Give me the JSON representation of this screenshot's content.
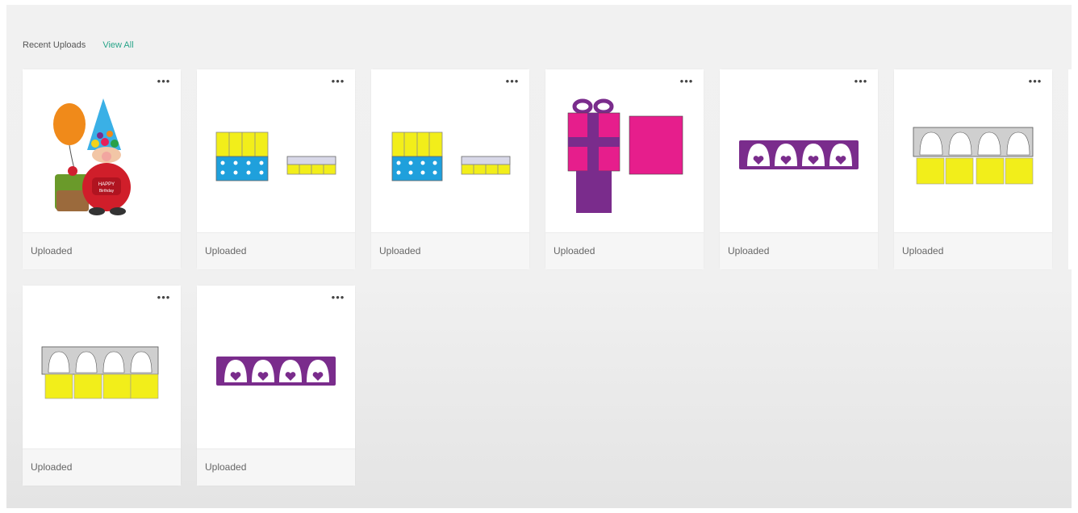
{
  "section": {
    "title": "Recent Uploads",
    "view_all": "View All"
  },
  "more_label": "•••",
  "cards": [
    {
      "status": "Uploaded",
      "image": "gnome-with-balloon"
    },
    {
      "status": "Uploaded",
      "image": "yellow-blue-box-pieces"
    },
    {
      "status": "Uploaded",
      "image": "yellow-blue-box-pieces"
    },
    {
      "status": "Uploaded",
      "image": "pink-purple-gift-box"
    },
    {
      "status": "Uploaded",
      "image": "purple-gnome-strip"
    },
    {
      "status": "Uploaded",
      "image": "gray-yellow-gnome-box"
    },
    {
      "status": "Uploaded",
      "image": "gray-yellow-gnome-box"
    },
    {
      "status": "Uploaded",
      "image": "purple-gnome-strip"
    }
  ],
  "colors": {
    "yellow": "#f2ee1a",
    "blue": "#1fa0dc",
    "pink": "#e61e8c",
    "purple": "#7a2c8c",
    "accent": "#2aa58a"
  }
}
